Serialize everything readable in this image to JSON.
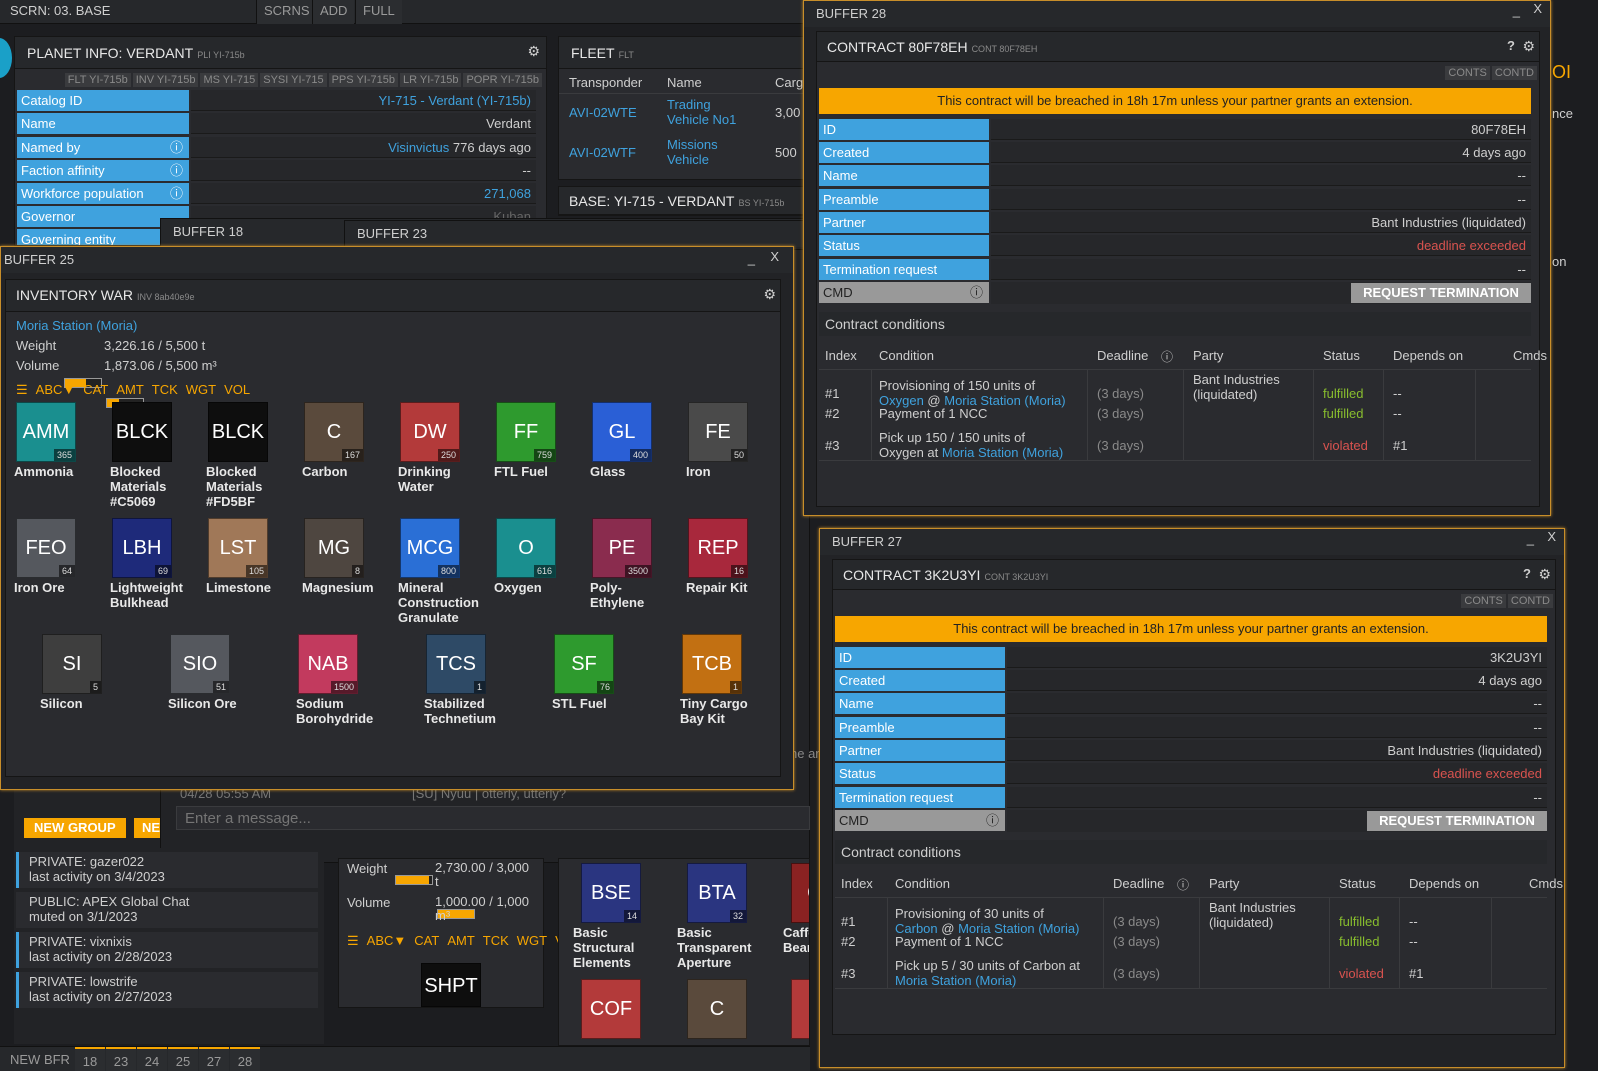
{
  "topbar": {
    "screen": "SCRN: 03. BASE",
    "buttons": [
      "SCRNS",
      "ADD",
      "FULL"
    ]
  },
  "bottombar": {
    "new_bfr": "NEW BFR",
    "tabs": [
      "18",
      "23",
      "24",
      "25",
      "27",
      "28"
    ]
  },
  "planet": {
    "title": "PLANET INFO: VERDANT",
    "title_small": "PLI YI-715b",
    "tabs": [
      "FLT YI-715b",
      "INV YI-715b",
      "MS YI-715",
      "SYSI YI-715",
      "PPS YI-715b",
      "LR YI-715b",
      "POPR YI-715b"
    ],
    "rows": [
      {
        "label": "Catalog ID",
        "value": "YI-715 - Verdant (YI-715b)"
      },
      {
        "label": "Name",
        "value": "Verdant"
      },
      {
        "label": "Named by",
        "value_link": "Visinvictus",
        "value": "776 days ago"
      },
      {
        "label": "Faction affinity",
        "value": "--"
      },
      {
        "label": "Workforce population",
        "value": "271,068"
      },
      {
        "label": "Governor",
        "value": "Kuban"
      },
      {
        "label": "Governing entity",
        "value": ""
      }
    ]
  },
  "fleet": {
    "title": "FLEET",
    "title_small": "FLT",
    "headers": [
      "Transponder",
      "Name",
      "Carg"
    ],
    "rows": [
      {
        "transponder": "AVI-02WTE",
        "name_l1": "Trading",
        "name_l2": "Vehicle No1",
        "cargo": "3,00"
      },
      {
        "transponder": "AVI-02WTF",
        "name_l1": "Missions",
        "name_l2": "Vehicle",
        "cargo": "500"
      }
    ]
  },
  "base": {
    "title": "BASE: YI-715 - VERDANT",
    "title_small": "BS YI-715b"
  },
  "buf18": {
    "title": "BUFFER 18"
  },
  "buf23": {
    "title": "BUFFER 23"
  },
  "buf25": {
    "title": "BUFFER 25",
    "min": "_",
    "close": "X",
    "tile_title": "INVENTORY WAR",
    "tile_small": "INV 8ab40e9e",
    "location": "Moria Station (Moria)",
    "weight_label": "Weight",
    "weight_value": "3,226.16 / 5,500 t",
    "weight_fill": 0.59,
    "volume_label": "Volume",
    "volume_value": "1,873.06 / 5,500 m³",
    "volume_fill": 0.34,
    "sort": [
      "ABC▼",
      "CAT",
      "AMT",
      "TCK",
      "WGT",
      "VOL"
    ],
    "materials": [
      {
        "t": "AMM",
        "c": "365",
        "n1": "Ammonia",
        "n2": "",
        "n3": "",
        "bg": "#1a8f8f"
      },
      {
        "t": "BLCK",
        "c": "",
        "n1": "Blocked",
        "n2": "Materials",
        "n3": "#C5069",
        "bg": "#0e0e0e"
      },
      {
        "t": "BLCK",
        "c": "",
        "n1": "Blocked",
        "n2": "Materials",
        "n3": "#FD5BF",
        "bg": "#0e0e0e"
      },
      {
        "t": "C",
        "c": "167",
        "n1": "Carbon",
        "n2": "",
        "n3": "",
        "bg": "#5a4a3c"
      },
      {
        "t": "DW",
        "c": "250",
        "n1": "Drinking",
        "n2": "Water",
        "n3": "",
        "bg": "#b33a3a"
      },
      {
        "t": "FF",
        "c": "759",
        "n1": "FTL Fuel",
        "n2": "",
        "n3": "",
        "bg": "#2e9a2e"
      },
      {
        "t": "GL",
        "c": "400",
        "n1": "Glass",
        "n2": "",
        "n3": "",
        "bg": "#2a5fd6"
      },
      {
        "t": "FE",
        "c": "50",
        "n1": "Iron",
        "n2": "",
        "n3": "",
        "bg": "#4a4a4a"
      },
      {
        "t": "FEO",
        "c": "64",
        "n1": "Iron Ore",
        "n2": "",
        "n3": "",
        "bg": "#55585e"
      },
      {
        "t": "LBH",
        "c": "69",
        "n1": "Lightweight",
        "n2": "Bulkhead",
        "n3": "",
        "bg": "#1e2a7a"
      },
      {
        "t": "LST",
        "c": "105",
        "n1": "Limestone",
        "n2": "",
        "n3": "",
        "bg": "#a07858"
      },
      {
        "t": "MG",
        "c": "8",
        "n1": "Magnesium",
        "n2": "",
        "n3": "",
        "bg": "#4e4640"
      },
      {
        "t": "MCG",
        "c": "800",
        "n1": "Mineral",
        "n2": "Construction",
        "n3": "Granulate",
        "bg": "#2a6fd6"
      },
      {
        "t": "O",
        "c": "616",
        "n1": "Oxygen",
        "n2": "",
        "n3": "",
        "bg": "#1a8f8f"
      },
      {
        "t": "PE",
        "c": "3500",
        "n1": "Poly-",
        "n2": "Ethylene",
        "n3": "",
        "bg": "#8a2c4e"
      },
      {
        "t": "REP",
        "c": "16",
        "n1": "Repair Kit",
        "n2": "",
        "n3": "",
        "bg": "#a8283c"
      },
      {
        "t": "SI",
        "c": "5",
        "n1": "Silicon",
        "n2": "",
        "n3": "",
        "bg": "#3e3e3e"
      },
      {
        "t": "SIO",
        "c": "51",
        "n1": "Silicon Ore",
        "n2": "",
        "n3": "",
        "bg": "#55585e"
      },
      {
        "t": "NAB",
        "c": "1500",
        "n1": "Sodium",
        "n2": "Borohydride",
        "n3": "",
        "bg": "#c23a5e"
      },
      {
        "t": "TCS",
        "c": "1",
        "n1": "Stabilized",
        "n2": "Technetium",
        "n3": "",
        "bg": "#2e4a66"
      },
      {
        "t": "SF",
        "c": "76",
        "n1": "STL Fuel",
        "n2": "",
        "n3": "",
        "bg": "#2e9a2e"
      },
      {
        "t": "TCB",
        "c": "1",
        "n1": "Tiny Cargo",
        "n2": "Bay Kit",
        "n3": "",
        "bg": "#c27012"
      }
    ]
  },
  "chat": {
    "timestamp": "04/28 05:55 AM",
    "line": "[SU] Nyuu | otterly, utterly?",
    "placeholder": "Enter a message...",
    "new_group": "NEW GROUP",
    "ne": "NE",
    "side_text": "he ar",
    "items": [
      {
        "l1": "PRIVATE: gazer022",
        "l2": "last activity on 3/4/2023"
      },
      {
        "l1": "PUBLIC: APEX Global Chat",
        "l2": "muted on 3/1/2023"
      },
      {
        "l1": "PRIVATE: vixnixis",
        "l2": "last activity on 2/28/2023"
      },
      {
        "l1": "PRIVATE: lowstrife",
        "l2": "last activity on 2/27/2023"
      }
    ]
  },
  "inv2": {
    "weight_label": "Weight",
    "weight_value": "2,730.00 / 3,000",
    "weight_unit": "t",
    "weight_fill": 0.91,
    "volume_label": "Volume",
    "volume_value": "1,000.00 / 1,000",
    "volume_unit": "m³",
    "volume_fill": 1.0,
    "sort": [
      "ABC▼",
      "CAT",
      "AMT",
      "TCK",
      "WGT",
      "V"
    ],
    "shpt": "SHPT"
  },
  "inv3": {
    "materials": [
      {
        "t": "BSE",
        "c": "14",
        "n1": "Basic",
        "n2": "Structural",
        "n3": "Elements",
        "bg": "#2a3580"
      },
      {
        "t": "BTA",
        "c": "32",
        "n1": "Basic",
        "n2": "Transparent",
        "n3": "Aperture",
        "bg": "#2a3580"
      },
      {
        "t": "CA",
        "c": "",
        "n1": "Caffei",
        "n2": "Beans",
        "n3": "",
        "bg": "#8a2222"
      }
    ],
    "bottom": [
      "COF",
      "C",
      "D"
    ]
  },
  "side_right": {
    "t1": "OI",
    "t2": "nce",
    "t3": "on"
  },
  "contracts": [
    {
      "buffer": "BUFFER 28",
      "title": "CONTRACT 80F78EH",
      "title_small": "CONT 80F78EH",
      "min": "_",
      "close": "X",
      "help": "?",
      "tabs": [
        "CONTS",
        "CONTD"
      ],
      "warning": "This contract will be breached in 18h 17m unless your partner grants an extension.",
      "rows": [
        {
          "label": "ID",
          "value": "80F78EH"
        },
        {
          "label": "Created",
          "value": "4 days ago"
        },
        {
          "label": "Name",
          "value": "--"
        },
        {
          "label": "Preamble",
          "value": "--"
        },
        {
          "label": "Partner",
          "value": "Bant Industries (liquidated)"
        },
        {
          "label": "Status",
          "value": "deadline exceeded"
        },
        {
          "label": "Termination request",
          "value": "--"
        }
      ],
      "cmd_label": "CMD",
      "cmd_button": "REQUEST TERMINATION",
      "conditions_title": "Contract conditions",
      "headers": [
        "Index",
        "Condition",
        "Deadline",
        "Party",
        "Status",
        "Depends on",
        "Cmds"
      ],
      "party_l1": "Bant Industries",
      "party_l2": "(liquidated)",
      "conds": [
        {
          "idx": "#1",
          "c1": "Provisioning of 150 units of",
          "c2a": "Oxygen",
          "c2b": " @ ",
          "c2c": "Moria Station (Moria)",
          "deadline": "(3 days)",
          "status": "fulfilled",
          "dep": "--"
        },
        {
          "idx": "#2",
          "c1": "Payment of 1 NCC",
          "c2a": "",
          "c2b": "",
          "c2c": "",
          "deadline": "(3 days)",
          "status": "fulfilled",
          "dep": "--"
        },
        {
          "idx": "#3",
          "c1": "Pick up 150 / 150 units of",
          "c2a": "",
          "c2b": "Oxygen at ",
          "c2c": "Moria Station (Moria)",
          "deadline": "(3 days)",
          "status": "violated",
          "dep": "#1"
        }
      ]
    },
    {
      "buffer": "BUFFER 27",
      "title": "CONTRACT 3K2U3YI",
      "title_small": "CONT 3K2U3YI",
      "min": "_",
      "close": "X",
      "help": "?",
      "tabs": [
        "CONTS",
        "CONTD"
      ],
      "warning": "This contract will be breached in 18h 17m unless your partner grants an extension.",
      "rows": [
        {
          "label": "ID",
          "value": "3K2U3YI"
        },
        {
          "label": "Created",
          "value": "4 days ago"
        },
        {
          "label": "Name",
          "value": "--"
        },
        {
          "label": "Preamble",
          "value": "--"
        },
        {
          "label": "Partner",
          "value": "Bant Industries (liquidated)"
        },
        {
          "label": "Status",
          "value": "deadline exceeded"
        },
        {
          "label": "Termination request",
          "value": "--"
        }
      ],
      "cmd_label": "CMD",
      "cmd_button": "REQUEST TERMINATION",
      "conditions_title": "Contract conditions",
      "headers": [
        "Index",
        "Condition",
        "Deadline",
        "Party",
        "Status",
        "Depends on",
        "Cmds"
      ],
      "party_l1": "Bant Industries",
      "party_l2": "(liquidated)",
      "conds": [
        {
          "idx": "#1",
          "c1": "Provisioning of 30 units of",
          "c2a": "Carbon",
          "c2b": " @ ",
          "c2c": "Moria Station (Moria)",
          "deadline": "(3 days)",
          "status": "fulfilled",
          "dep": "--"
        },
        {
          "idx": "#2",
          "c1": "Payment of 1 NCC",
          "c2a": "",
          "c2b": "",
          "c2c": "",
          "deadline": "(3 days)",
          "status": "fulfilled",
          "dep": "--"
        },
        {
          "idx": "#3",
          "c1": "Pick up 5 / 30 units of Carbon at",
          "c2a": "",
          "c2b": "",
          "c2c": "Moria Station (Moria)",
          "deadline": "(3 days)",
          "status": "violated",
          "dep": "#1"
        }
      ]
    }
  ]
}
